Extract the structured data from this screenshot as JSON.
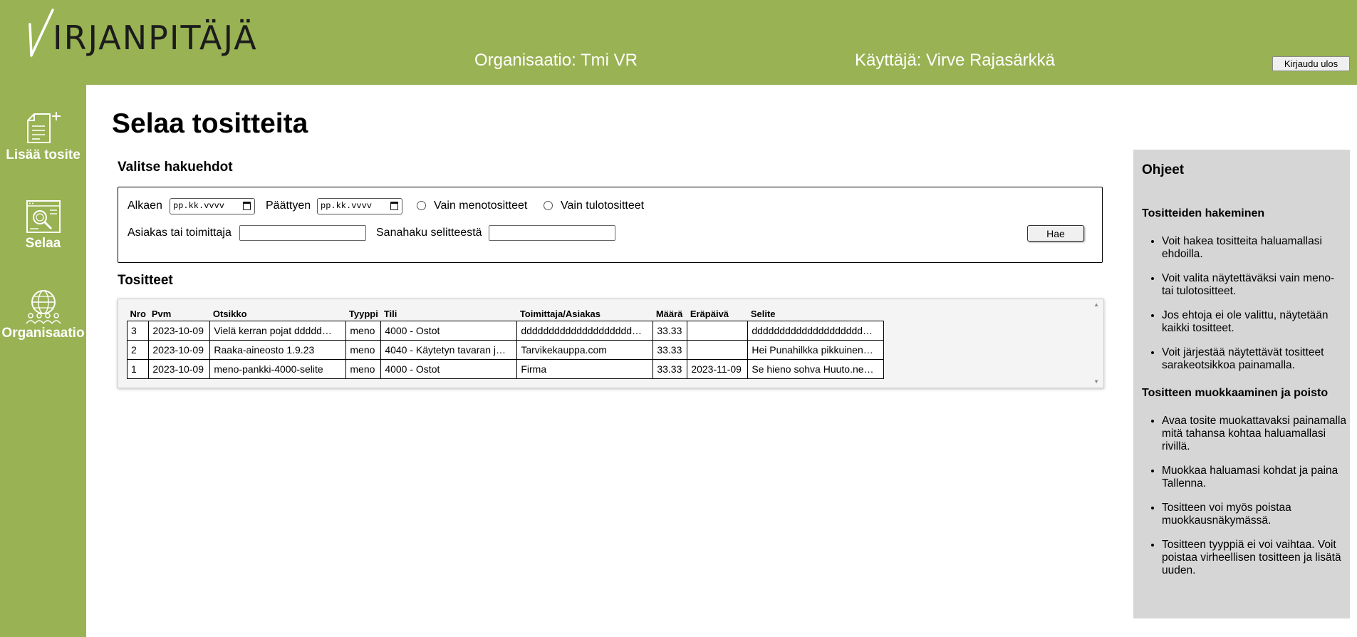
{
  "header": {
    "logo_text": "IRJANPITÄJÄ",
    "organization": "Organisaatio: Tmi VR",
    "user": "Käyttäjä: Virve Rajasärkkä",
    "logout_label": "Kirjaudu ulos"
  },
  "sidebar": {
    "items": [
      {
        "label": "Lisää tosite",
        "icon": "add-document-icon"
      },
      {
        "label": "Selaa",
        "icon": "browse-search-icon"
      },
      {
        "label": "Organisaatio",
        "icon": "organization-globe-icon"
      }
    ]
  },
  "main": {
    "title": "Selaa tositteita",
    "filters": {
      "heading": "Valitse hakuehdot",
      "start_label": "Alkaen",
      "start_placeholder": "pp.kk.vvvv",
      "end_label": "Päättyen",
      "end_placeholder": "pp.kk.vvvv",
      "only_expenses_label": "Vain menotositteet",
      "only_income_label": "Vain tulotositteet",
      "customer_label": "Asiakas tai toimittaja",
      "customer_value": "",
      "text_search_label": "Sanahaku selitteestä",
      "text_search_value": "",
      "search_button": "Hae"
    },
    "results": {
      "heading": "Tositteet",
      "columns": [
        "Nro",
        "Pvm",
        "Otsikko",
        "Tyyppi",
        "Tili",
        "Toimittaja/Asiakas",
        "Määrä",
        "Eräpäivä",
        "Selite"
      ],
      "rows": [
        [
          "3",
          "2023-10-09",
          "Vielä kerran pojat ddddd…",
          "meno",
          "4000 - Ostot",
          "dddddddddddddddddddd…",
          "33.33",
          "",
          "dddddddddddddddddddd…"
        ],
        [
          "2",
          "2023-10-09",
          "Raaka-aineosto 1.9.23",
          "meno",
          "4040 - Käytetyn tavaran j…",
          "Tarvikekauppa.com",
          "33.33",
          "",
          "Hei Punahilkka pikkuinen…"
        ],
        [
          "1",
          "2023-10-09",
          "meno-pankki-4000-selite",
          "meno",
          "4000 - Ostot",
          "Firma",
          "33.33",
          "2023-11-09",
          "Se hieno sohva Huuto.ne…"
        ]
      ]
    }
  },
  "help": {
    "title": "Ohjeet",
    "sections": [
      {
        "heading": "Tositteiden hakeminen",
        "items": [
          "Voit hakea tositteita haluamallasi ehdoilla.",
          "Voit valita näytettäväksi vain meno- tai tulotositteet.",
          "Jos ehtoja ei ole valittu, näytetään kaikki tositteet.",
          "Voit järjestää näytettävät tositteet sarakeotsikkoa painamalla."
        ]
      },
      {
        "heading": "Tositteen muokkaaminen ja poisto",
        "items": [
          "Avaa tosite muokattavaksi painamalla mitä tahansa kohtaa haluamallasi rivillä.",
          "Muokkaa haluamasi kohdat ja paina Tallenna.",
          "Tositteen voi myös poistaa muokkausnäkymässä.",
          "Tositteen tyyppiä ei voi vaihtaa. Voit poistaa virheellisen tositteen ja lisätä uuden."
        ]
      }
    ]
  },
  "colors": {
    "brand_green": "#99b253",
    "help_panel_bg": "#d6d6d6"
  }
}
